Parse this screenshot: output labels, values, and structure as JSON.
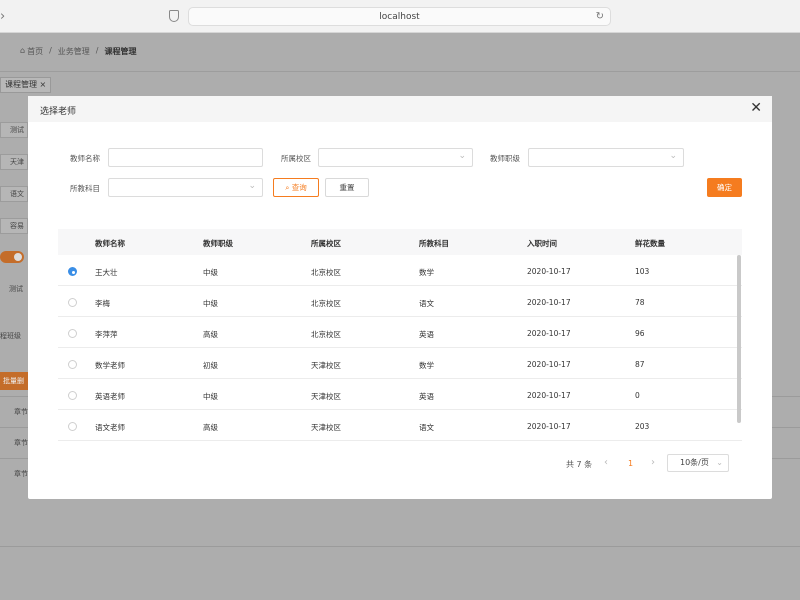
{
  "browser": {
    "url": "localhost"
  },
  "background": {
    "breadcrumb": [
      "首页",
      "业务管理",
      "课程管理"
    ],
    "tab_label": "课程管理",
    "side_cells": [
      "测试",
      "天津",
      "语文",
      "容易",
      "测试",
      "程班级"
    ],
    "batch_label": "批量删",
    "chapter_cells": [
      "章节",
      "章节",
      "章节"
    ]
  },
  "modal": {
    "title": "选择老师",
    "filters": {
      "teacher_name_label": "教师名称",
      "campus_label": "所属校区",
      "rank_label": "教师职级",
      "subject_label": "所教科目",
      "teacher_name_value": "",
      "campus_value": "",
      "rank_value": "",
      "subject_value": ""
    },
    "buttons": {
      "query": "查询",
      "reset": "重置",
      "confirm": "确定"
    },
    "table": {
      "headers": [
        "教师名称",
        "教师职级",
        "所属校区",
        "所教科目",
        "入职时间",
        "鲜花数量"
      ],
      "rows": [
        {
          "name": "王大壮",
          "rank": "中级",
          "campus": "北京校区",
          "subject": "数学",
          "joined": "2020-10-17",
          "flowers": "103",
          "selected": true
        },
        {
          "name": "李梅",
          "rank": "中级",
          "campus": "北京校区",
          "subject": "语文",
          "joined": "2020-10-17",
          "flowers": "78",
          "selected": false
        },
        {
          "name": "李萍萍",
          "rank": "高级",
          "campus": "北京校区",
          "subject": "英语",
          "joined": "2020-10-17",
          "flowers": "96",
          "selected": false
        },
        {
          "name": "数学老师",
          "rank": "初级",
          "campus": "天津校区",
          "subject": "数学",
          "joined": "2020-10-17",
          "flowers": "87",
          "selected": false
        },
        {
          "name": "英语老师",
          "rank": "中级",
          "campus": "天津校区",
          "subject": "英语",
          "joined": "2020-10-17",
          "flowers": "0",
          "selected": false
        },
        {
          "name": "语文老师",
          "rank": "高级",
          "campus": "天津校区",
          "subject": "语文",
          "joined": "2020-10-17",
          "flowers": "203",
          "selected": false
        }
      ]
    },
    "pagination": {
      "total_text": "共 7 条",
      "current_page": "1",
      "page_size": "10条/页"
    }
  },
  "colors": {
    "accent": "#f57c1f",
    "radio_selected": "#3a8ee6"
  }
}
